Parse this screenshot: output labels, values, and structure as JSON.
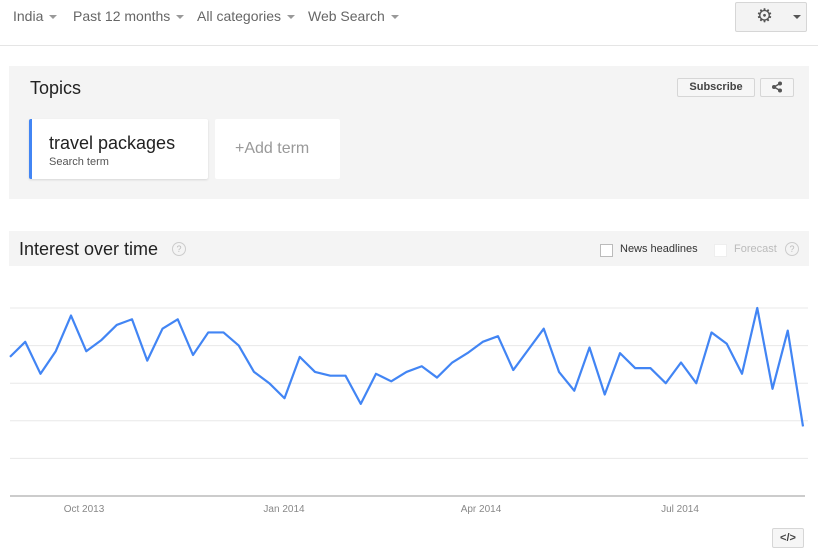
{
  "filters": [
    {
      "label": "India"
    },
    {
      "label": "Past 12 months"
    },
    {
      "label": "All categories"
    },
    {
      "label": "Web Search"
    }
  ],
  "settings": {
    "icon": "gear-icon"
  },
  "topics": {
    "title": "Topics",
    "subscribe_label": "Subscribe",
    "share_icon": "share-icon",
    "term": {
      "name": "travel packages",
      "type": "Search term",
      "color": "#4285f4"
    },
    "add_term_label": "+Add term"
  },
  "interest": {
    "title": "Interest over time",
    "help": "?",
    "news_headlines_label": "News headlines",
    "forecast_label": "Forecast",
    "forecast_help": "?"
  },
  "embed_label": "</>",
  "chart_data": {
    "type": "line",
    "title": "Interest over time",
    "xlabel": "",
    "ylabel": "",
    "ylim": [
      0,
      100
    ],
    "grid": true,
    "x_tick_labels": [
      "Oct 2013",
      "Jan 2014",
      "Apr 2014",
      "Jul 2014"
    ],
    "series": [
      {
        "name": "travel packages",
        "color": "#4285f4",
        "values": [
          74,
          82,
          65,
          77,
          96,
          77,
          83,
          91,
          94,
          72,
          89,
          94,
          75,
          87,
          87,
          80,
          66,
          60,
          52,
          74,
          66,
          64,
          64,
          49,
          65,
          61,
          66,
          69,
          63,
          71,
          76,
          82,
          85,
          67,
          78,
          89,
          66,
          56,
          79,
          54,
          76,
          68,
          68,
          60,
          71,
          60,
          87,
          81,
          65,
          100,
          57,
          88,
          37
        ]
      }
    ]
  }
}
